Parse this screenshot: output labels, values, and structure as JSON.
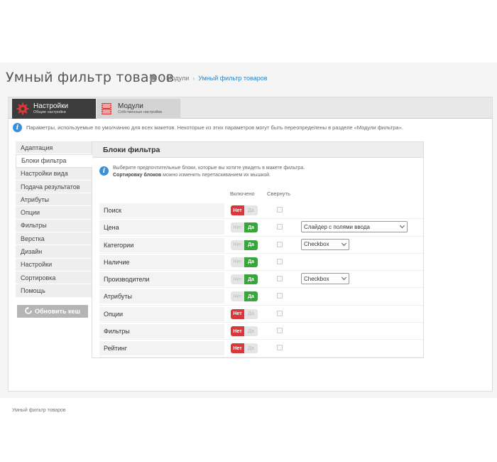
{
  "page": {
    "title": "Умный фильтр товаров",
    "breadcrumb": {
      "home_icon": "home-icon",
      "items": [
        "Модули",
        "Умный фильтр товаров"
      ]
    }
  },
  "tabs": [
    {
      "title": "Настройки",
      "subtitle": "Общие настройки",
      "icon": "gear-icon",
      "active": true
    },
    {
      "title": "Модули",
      "subtitle": "Собственные настройки",
      "icon": "film-icon",
      "active": false
    }
  ],
  "info": "Параметры, используемые по умолчанию для всех макетов. Некоторые из этих параметров могут быть переопределены в разделе «Модули фильтра».",
  "sidebar": {
    "items": [
      "Адаптация",
      "Блоки фильтра",
      "Настройки вида",
      "Подача результатов",
      "Атрибуты",
      "Опции",
      "Фильтры",
      "Верстка",
      "Дизайн",
      "Настройки",
      "Сортировка",
      "Помощь"
    ],
    "active_index": 1,
    "refresh_label": "Обновить кеш"
  },
  "panel": {
    "title": "Блоки фильтра",
    "info_line1": "Выберите предпочтительные блоки, которые вы хотите увидеть в макете фильтра.",
    "info_bold": "Сортировку блоков",
    "info_line2": " можно изменить перетаскиванием их мышкой.",
    "col_enabled": "Включено",
    "col_collapse": "Свернуть",
    "toggle_no": "Нет",
    "toggle_yes": "Да",
    "rows": [
      {
        "label": "Поиск",
        "enabled": false,
        "collapsed": false,
        "select": ""
      },
      {
        "label": "Цена",
        "enabled": true,
        "collapsed": false,
        "select": "Слайдер с полями ввода"
      },
      {
        "label": "Категории",
        "enabled": true,
        "collapsed": false,
        "select": "Checkbox"
      },
      {
        "label": "Наличие",
        "enabled": true,
        "collapsed": false,
        "select": ""
      },
      {
        "label": "Производители",
        "enabled": true,
        "collapsed": false,
        "select": "Checkbox"
      },
      {
        "label": "Атрибуты",
        "enabled": true,
        "collapsed": false,
        "select": ""
      },
      {
        "label": "Опции",
        "enabled": false,
        "collapsed": false,
        "select": ""
      },
      {
        "label": "Фильтры",
        "enabled": false,
        "collapsed": false,
        "select": ""
      },
      {
        "label": "Рейтинг",
        "enabled": false,
        "collapsed": false,
        "select": ""
      }
    ]
  },
  "footer": "Умный фильтр товаров",
  "colors": {
    "accent": "#2a86c8",
    "on": "#3aa53f",
    "off": "#d9383a",
    "tab_active": "#3c3c3c",
    "icon_red": "#d9383a"
  }
}
